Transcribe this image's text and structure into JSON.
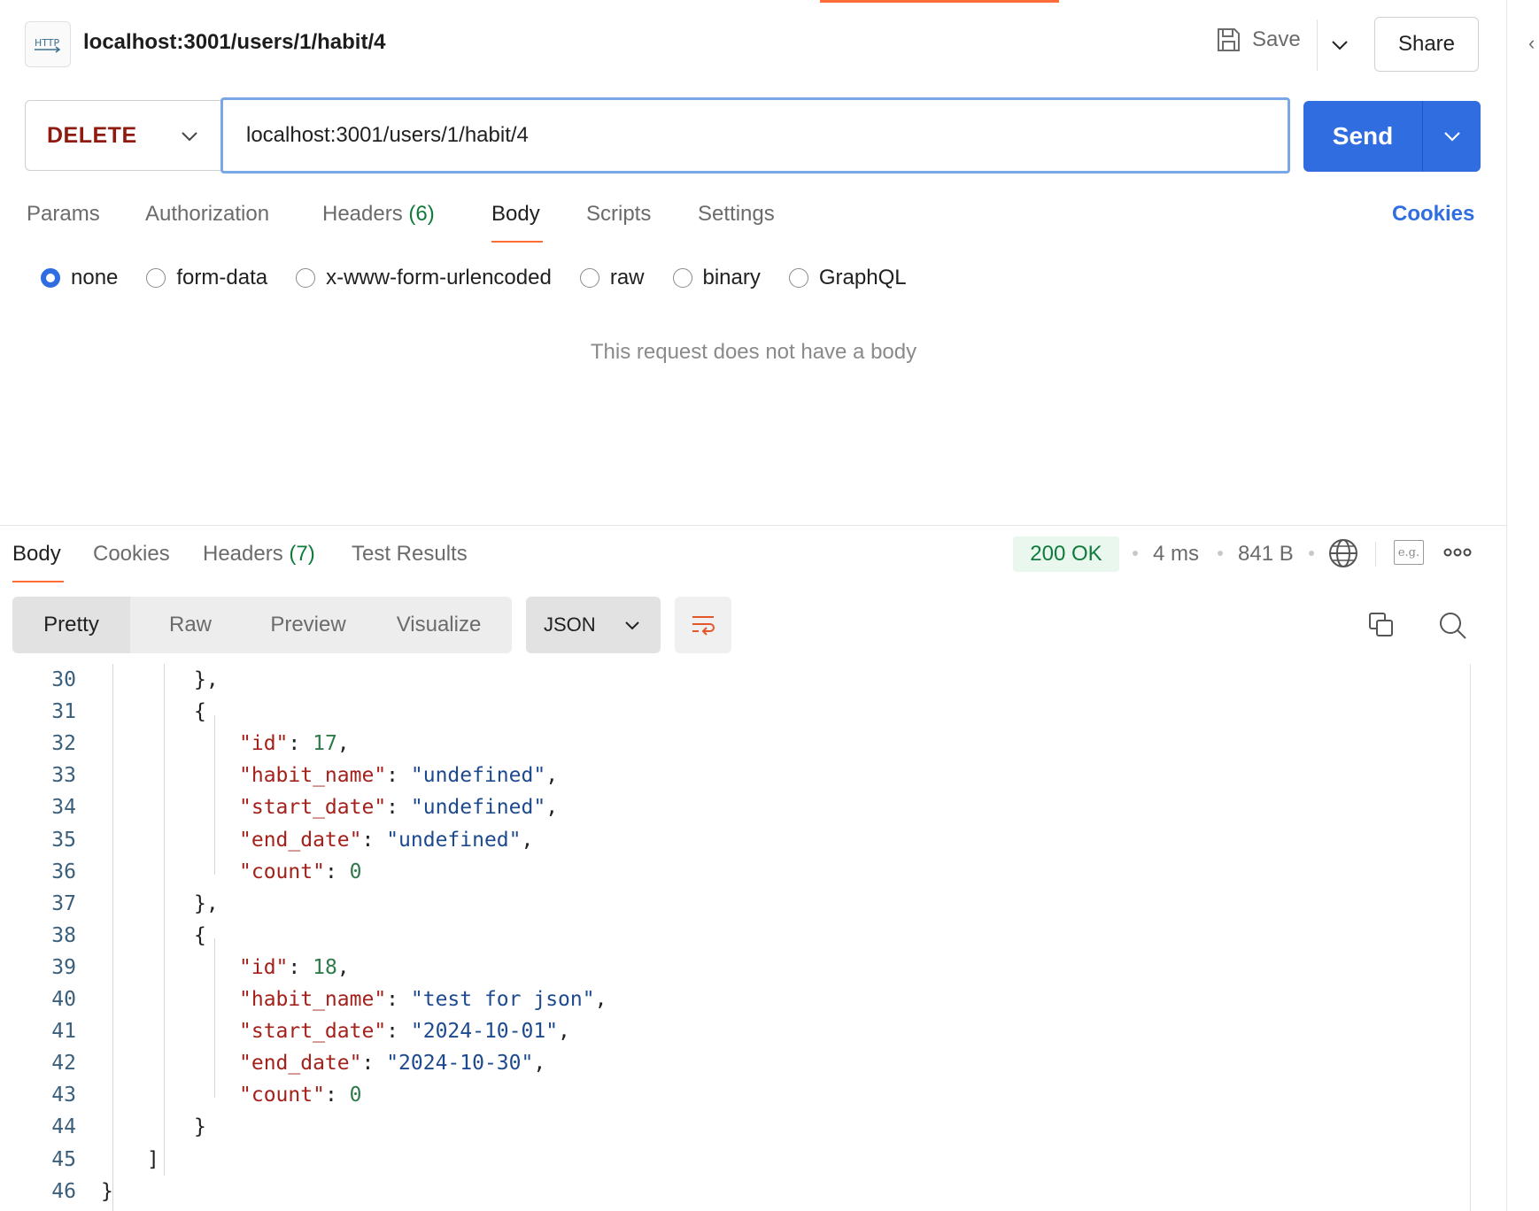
{
  "header": {
    "badge": "HTTP",
    "title": "localhost:3001/users/1/habit/4",
    "save_label": "Save",
    "share_label": "Share"
  },
  "request": {
    "method": "DELETE",
    "url": "localhost:3001/users/1/habit/4",
    "send_label": "Send",
    "tabs": [
      {
        "label": "Params"
      },
      {
        "label": "Authorization"
      },
      {
        "label": "Headers",
        "count": "(6)"
      },
      {
        "label": "Body",
        "active": true
      },
      {
        "label": "Scripts"
      },
      {
        "label": "Settings"
      }
    ],
    "cookies_label": "Cookies",
    "body_types": [
      "none",
      "form-data",
      "x-www-form-urlencoded",
      "raw",
      "binary",
      "GraphQL"
    ],
    "body_type_selected": "none",
    "empty_body_message": "This request does not have a body"
  },
  "response": {
    "tabs": [
      {
        "label": "Body",
        "active": true
      },
      {
        "label": "Cookies"
      },
      {
        "label": "Headers",
        "count": "(7)"
      },
      {
        "label": "Test Results"
      }
    ],
    "status": "200 OK",
    "time": "4 ms",
    "size": "841 B",
    "example_badge": "e.g.",
    "view_modes": [
      "Pretty",
      "Raw",
      "Preview",
      "Visualize"
    ],
    "view_selected": "Pretty",
    "format": "JSON",
    "code_lines": [
      {
        "n": "30",
        "text": "},"
      },
      {
        "n": "31",
        "text": "{"
      },
      {
        "n": "32",
        "key": "\"id\"",
        "val": "17",
        "type": "num",
        "comma": true
      },
      {
        "n": "33",
        "key": "\"habit_name\"",
        "val": "\"undefined\"",
        "type": "str",
        "comma": true
      },
      {
        "n": "34",
        "key": "\"start_date\"",
        "val": "\"undefined\"",
        "type": "str",
        "comma": true
      },
      {
        "n": "35",
        "key": "\"end_date\"",
        "val": "\"undefined\"",
        "type": "str",
        "comma": true
      },
      {
        "n": "36",
        "key": "\"count\"",
        "val": "0",
        "type": "num",
        "comma": false
      },
      {
        "n": "37",
        "text": "},"
      },
      {
        "n": "38",
        "text": "{"
      },
      {
        "n": "39",
        "key": "\"id\"",
        "val": "18",
        "type": "num",
        "comma": true
      },
      {
        "n": "40",
        "key": "\"habit_name\"",
        "val": "\"test for json\"",
        "type": "str",
        "comma": true
      },
      {
        "n": "41",
        "key": "\"start_date\"",
        "val": "\"2024-10-01\"",
        "type": "str",
        "comma": true
      },
      {
        "n": "42",
        "key": "\"end_date\"",
        "val": "\"2024-10-30\"",
        "type": "str",
        "comma": true
      },
      {
        "n": "43",
        "key": "\"count\"",
        "val": "0",
        "type": "num",
        "comma": false
      },
      {
        "n": "44",
        "text": "}"
      },
      {
        "n": "45",
        "text": "]"
      },
      {
        "n": "46",
        "text": "}"
      }
    ]
  },
  "colors": {
    "accent": "#2f6de1",
    "tab_indicator": "#ff6c37",
    "method_delete": "#8e1a10",
    "status_ok": "#0f7b3b",
    "json_key": "#a4211b",
    "json_string": "#1d4a8e",
    "json_number": "#2f7a4a"
  }
}
